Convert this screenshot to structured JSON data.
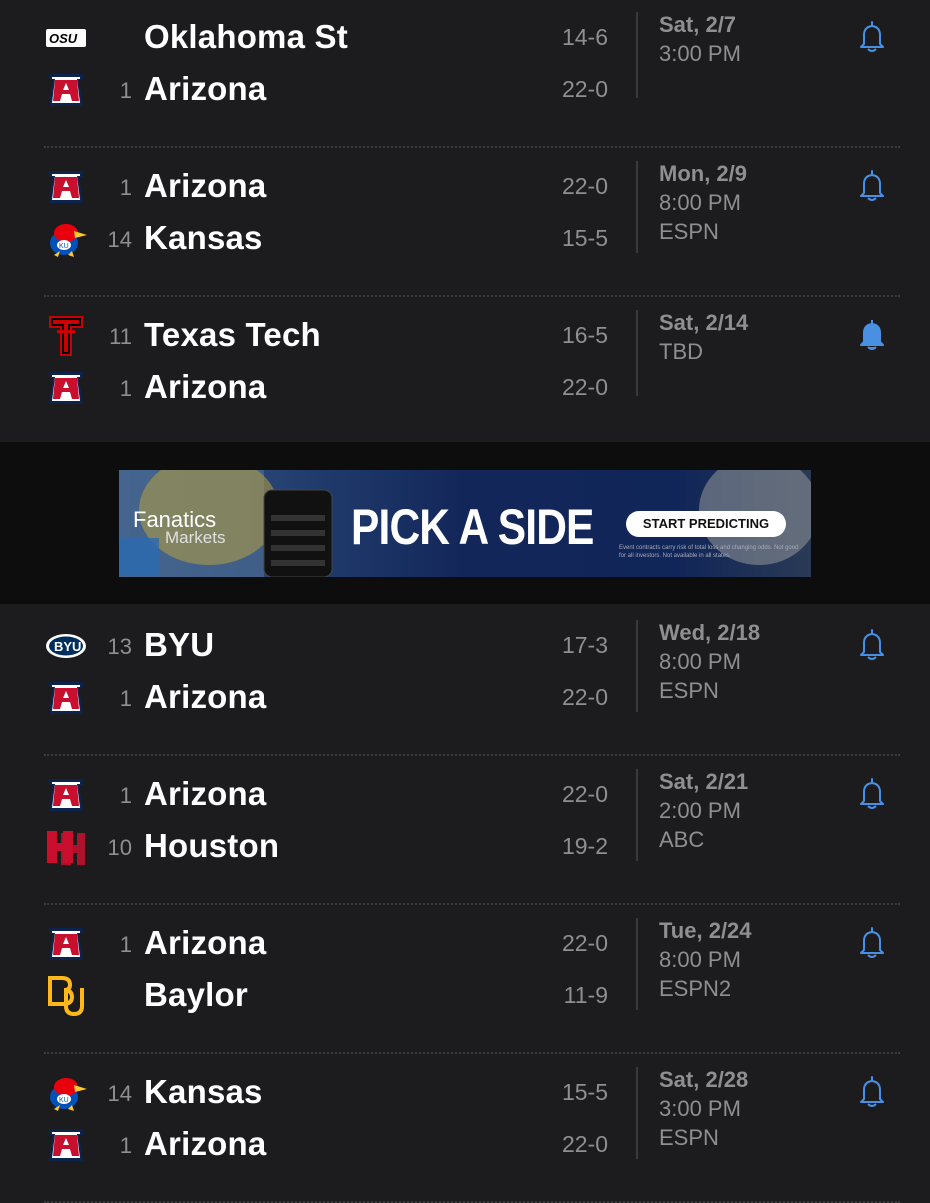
{
  "games": [
    {
      "teams": [
        {
          "logo": "oklahoma-state-logo",
          "rank": "",
          "name": "Oklahoma St",
          "record": "14-6"
        },
        {
          "logo": "arizona-logo",
          "rank": "1",
          "name": "Arizona",
          "record": "22-0"
        }
      ],
      "date": "Sat, 2/7",
      "time": "3:00 PM",
      "network": "",
      "bell": "bell-outline-icon"
    },
    {
      "teams": [
        {
          "logo": "arizona-logo",
          "rank": "1",
          "name": "Arizona",
          "record": "22-0"
        },
        {
          "logo": "kansas-logo",
          "rank": "14",
          "name": "Kansas",
          "record": "15-5"
        }
      ],
      "date": "Mon, 2/9",
      "time": "8:00 PM",
      "network": "ESPN",
      "bell": "bell-outline-icon"
    },
    {
      "teams": [
        {
          "logo": "texas-tech-logo",
          "rank": "11",
          "name": "Texas Tech",
          "record": "16-5"
        },
        {
          "logo": "arizona-logo",
          "rank": "1",
          "name": "Arizona",
          "record": "22-0"
        }
      ],
      "date": "Sat, 2/14",
      "time": "TBD",
      "network": "",
      "bell": "bell-filled-icon"
    },
    {
      "teams": [
        {
          "logo": "byu-logo",
          "rank": "13",
          "name": "BYU",
          "record": "17-3"
        },
        {
          "logo": "arizona-logo",
          "rank": "1",
          "name": "Arizona",
          "record": "22-0"
        }
      ],
      "date": "Wed, 2/18",
      "time": "8:00 PM",
      "network": "ESPN",
      "bell": "bell-outline-icon"
    },
    {
      "teams": [
        {
          "logo": "arizona-logo",
          "rank": "1",
          "name": "Arizona",
          "record": "22-0"
        },
        {
          "logo": "houston-logo",
          "rank": "10",
          "name": "Houston",
          "record": "19-2"
        }
      ],
      "date": "Sat, 2/21",
      "time": "2:00 PM",
      "network": "ABC",
      "bell": "bell-outline-icon"
    },
    {
      "teams": [
        {
          "logo": "arizona-logo",
          "rank": "1",
          "name": "Arizona",
          "record": "22-0"
        },
        {
          "logo": "baylor-logo",
          "rank": "",
          "name": "Baylor",
          "record": "11-9"
        }
      ],
      "date": "Tue, 2/24",
      "time": "8:00 PM",
      "network": "ESPN2",
      "bell": "bell-outline-icon"
    },
    {
      "teams": [
        {
          "logo": "kansas-logo",
          "rank": "14",
          "name": "Kansas",
          "record": "15-5"
        },
        {
          "logo": "arizona-logo",
          "rank": "1",
          "name": "Arizona",
          "record": "22-0"
        }
      ],
      "date": "Sat, 2/28",
      "time": "3:00 PM",
      "network": "ESPN",
      "bell": "bell-outline-icon"
    }
  ],
  "ad": {
    "brand": "Fanatics",
    "brand_sub": "Markets",
    "headline": "PICK A SIDE",
    "cta": "START PREDICTING",
    "fine_print": "Event contracts carry risk of total loss and changing odds. Not good for all investors. Not available in all states."
  },
  "colors": {
    "background": "#1c1c1e",
    "text_primary": "#ffffff",
    "text_secondary": "#8e8e93",
    "bell_accent": "#4a90e2",
    "arizona_red": "#c8102e",
    "arizona_navy": "#0c234b"
  }
}
